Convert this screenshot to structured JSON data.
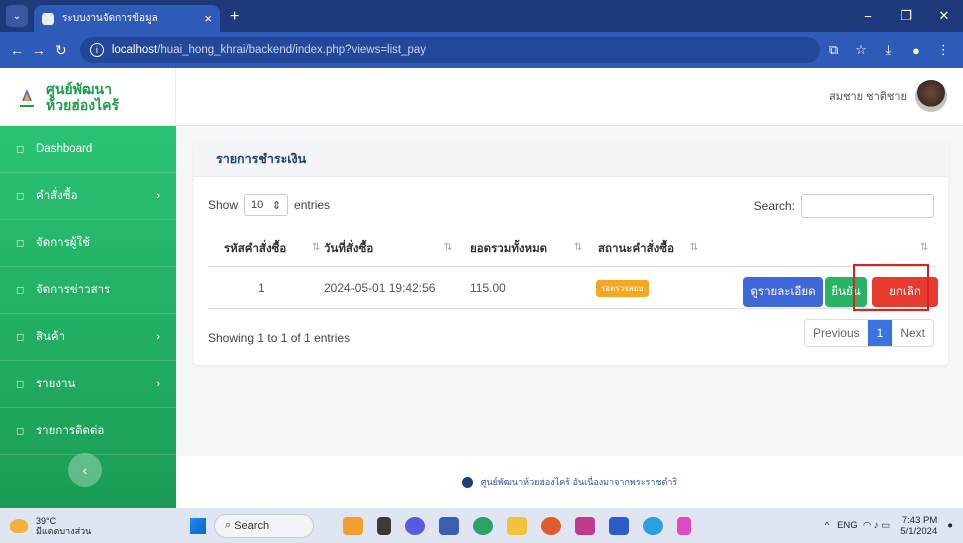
{
  "browser": {
    "tab_title": "ระบบงานจัดการข้อมูล",
    "tab_close": "×",
    "new_tab": "+",
    "url_host": "localhost",
    "url_path": "/huai_hong_khrai/backend/index.php?views=list_pay",
    "controls": {
      "minimize": "−",
      "restore": "❐",
      "close": "✕"
    }
  },
  "brand": {
    "line1": "ศูนย์พัฒนา",
    "line2": "ห้วยฮ่องไคร้"
  },
  "user": {
    "name": "สมชาย ชาติชาย"
  },
  "sidebar": {
    "items": [
      {
        "label": "Dashboard",
        "icon": "dashboard-icon",
        "chevron": false
      },
      {
        "label": "คำสั่งซื้อ",
        "icon": "orders-icon",
        "chevron": true
      },
      {
        "label": "จัดการผู้ใช้",
        "icon": "user-icon",
        "chevron": false
      },
      {
        "label": "จัดการข่าวสาร",
        "icon": "news-icon",
        "chevron": false
      },
      {
        "label": "สินค้า",
        "icon": "product-icon",
        "chevron": true
      },
      {
        "label": "รายงาน",
        "icon": "report-icon",
        "chevron": true
      },
      {
        "label": "รายการติดต่อ",
        "icon": "contact-icon",
        "chevron": false
      }
    ]
  },
  "card": {
    "title": "รายการชำระเงิน",
    "length": {
      "show": "Show",
      "value": "10",
      "entries": "entries"
    },
    "search_label": "Search:",
    "columns": [
      "รหัสคำสั่งซื้อ",
      "วันที่สั่งซื้อ",
      "ยอดรวมทั้งหมด",
      "สถานะคำสั่งซื้อ",
      ""
    ],
    "rows": [
      {
        "id": "1",
        "date": "2024-05-01 19:42:56",
        "total": "115.00",
        "status": "รอตรวจสอบ",
        "actions": {
          "detail": "ดูรายละเอียด",
          "confirm": "ยืนยัน",
          "cancel": "ยกเลิก"
        }
      }
    ],
    "info": "Showing 1 to 1 of 1 entries",
    "pager": {
      "prev": "Previous",
      "current": "1",
      "next": "Next"
    }
  },
  "footer": {
    "text": "ศูนย์พัฒนาห้วยฮ่องไคร้ อันเนื่องมาจากพระราชดำริ"
  },
  "taskbar": {
    "temp": "39°C",
    "weather": "มีแดดบางส่วน",
    "search": "Search",
    "lang": "ENG",
    "time": "7:43 PM",
    "date": "5/1/2024"
  },
  "colors": {
    "brand_green": "#1d9e4f",
    "sidebar_top": "#2ec878",
    "primary": "#4068d8",
    "success": "#28b463",
    "danger": "#e63b2e",
    "warning": "#f5a623",
    "highlight": "#e02020"
  }
}
